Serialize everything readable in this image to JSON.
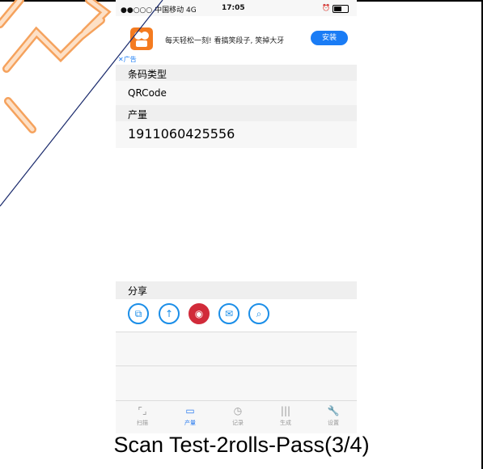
{
  "status_bar": {
    "carrier": "●●○○○ 中国移动  4G",
    "time": "17:05"
  },
  "ad": {
    "text": "每天轻松一刻! 看搞笑段子, 笑掉大牙",
    "install_label": "安装",
    "close_label": "✕广告"
  },
  "result": {
    "type_heading": "条码类型",
    "type_value": "QRCode",
    "product_heading": "产量",
    "product_value": "1911060425556"
  },
  "share": {
    "heading": "分享"
  },
  "tabs": [
    {
      "label": "扫描",
      "icon": "scan-icon"
    },
    {
      "label": "产量",
      "icon": "chat-icon"
    },
    {
      "label": "记录",
      "icon": "history-icon"
    },
    {
      "label": "生成",
      "icon": "barcode-icon"
    },
    {
      "label": "设置",
      "icon": "wrench-icon"
    }
  ],
  "caption": "Scan Test-2rolls-Pass(3/4)",
  "colors": {
    "accent": "#1a7cf5",
    "weibo": "#d12b3a",
    "overlay_orange": "#f5a25d"
  }
}
